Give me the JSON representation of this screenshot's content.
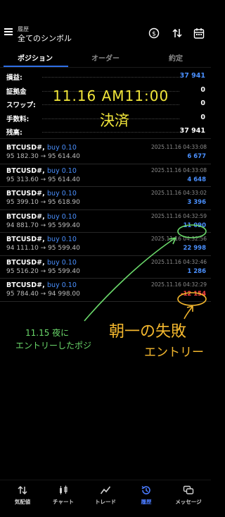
{
  "header": {
    "subtitle": "履歴",
    "title": "全てのシンボル"
  },
  "tabs": [
    {
      "label": "ポジション",
      "active": true
    },
    {
      "label": "オーダー",
      "active": false
    },
    {
      "label": "約定",
      "active": false
    }
  ],
  "summary": [
    {
      "label": "損益:",
      "value": "37 941",
      "color": "blue"
    },
    {
      "label": "証拠金",
      "value": "0",
      "color": "white"
    },
    {
      "label": "スワップ:",
      "value": "0",
      "color": "white"
    },
    {
      "label": "手数料:",
      "value": "0",
      "color": "white"
    },
    {
      "label": "残高:",
      "value": "37 941",
      "color": "white"
    }
  ],
  "trades": [
    {
      "symbol": "BTCUSD#,",
      "side": "buy 0.10",
      "prices": "95 182.30 → 95 614.40",
      "datetime": "2025.11.16 04:33:08",
      "profit": "6 677",
      "negative": false
    },
    {
      "symbol": "BTCUSD#,",
      "side": "buy 0.10",
      "prices": "95 313.60 → 95 614.40",
      "datetime": "2025.11.16 04:33:08",
      "profit": "4 648",
      "negative": false
    },
    {
      "symbol": "BTCUSD#,",
      "side": "buy 0.10",
      "prices": "95 399.10 → 95 618.90",
      "datetime": "2025.11.16 04:33:02",
      "profit": "3 396",
      "negative": false
    },
    {
      "symbol": "BTCUSD#,",
      "side": "buy 0.10",
      "prices": "94 881.70 → 95 599.40",
      "datetime": "2025.11.16 04:32:59",
      "profit": "11 090",
      "negative": false
    },
    {
      "symbol": "BTCUSD#,",
      "side": "buy 0.10",
      "prices": "94 111.10 → 95 599.40",
      "datetime": "2025.11.16 04:32:56",
      "profit": "22 998",
      "negative": false
    },
    {
      "symbol": "BTCUSD#,",
      "side": "buy 0.10",
      "prices": "95 516.20 → 95 599.40",
      "datetime": "2025.11.16 04:32:46",
      "profit": "1 286",
      "negative": false
    },
    {
      "symbol": "BTCUSD#,",
      "side": "buy 0.10",
      "prices": "95 784.40 → 94 998.00",
      "datetime": "2025.11.16 04:32:29",
      "profit": "-12 154",
      "negative": true
    }
  ],
  "annotations": {
    "settled_line1": "11.16 AM11:00",
    "settled_line2": "決済",
    "green_line1": "11.15 夜に",
    "green_line2": "エントリーしたポジ",
    "orange_line1": "朝一の失敗",
    "orange_line2": "エントリー",
    "colors": {
      "yellow": "#f2e63a",
      "green": "#6bd96b",
      "orange": "#f5b82e"
    }
  },
  "nav": [
    {
      "label": "気配値",
      "icon": "quotes-icon",
      "active": false
    },
    {
      "label": "チャート",
      "icon": "chart-icon",
      "active": false
    },
    {
      "label": "トレード",
      "icon": "trade-icon",
      "active": false
    },
    {
      "label": "履歴",
      "icon": "history-icon",
      "active": true
    },
    {
      "label": "メッセージ",
      "icon": "messages-icon",
      "active": false
    }
  ]
}
